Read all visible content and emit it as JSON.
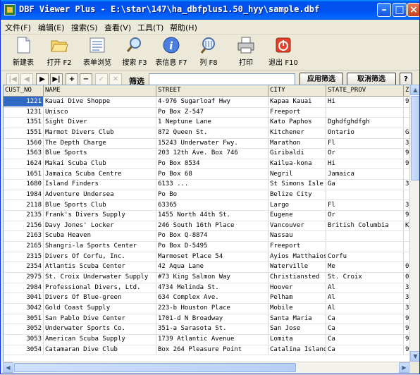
{
  "window": {
    "title": "DBF Viewer Plus - E:\\star\\147\\ha_dbfplus1.50_hyy\\sample.dbf"
  },
  "menu": [
    "文件(F)",
    "编辑(E)",
    "搜索(S)",
    "查看(V)",
    "工具(T)",
    "帮助(H)"
  ],
  "toolbar": [
    {
      "label": "新建表",
      "icon": "new-table-icon"
    },
    {
      "label": "打开 F2",
      "icon": "open-folder-icon"
    },
    {
      "label": "表单浏览",
      "icon": "form-browse-icon"
    },
    {
      "label": "搜索 F3",
      "icon": "search-icon"
    },
    {
      "label": "表信息 F7",
      "icon": "info-icon"
    },
    {
      "label": "列 F8",
      "icon": "columns-icon"
    },
    {
      "label": "打印",
      "icon": "printer-icon"
    },
    {
      "label": "退出 F10",
      "icon": "exit-icon"
    }
  ],
  "nav": {
    "first": "|◀",
    "prev": "◀",
    "next": "▶",
    "last": "▶|",
    "add": "+",
    "delete": "−",
    "post": "✓",
    "cancel": "✕"
  },
  "filter": {
    "label": "筛选",
    "value": "",
    "apply": "应用筛选",
    "cancel": "取消筛选",
    "help": "?"
  },
  "columns": [
    "CUST_NO",
    "NAME",
    "STREET",
    "CITY",
    "STATE_PROV",
    "Z"
  ],
  "rows": [
    [
      "1221",
      "Kauai Dive Shoppe",
      "4-976 Sugarloaf Hwy",
      "Kapaa Kauai",
      "Hi",
      "9"
    ],
    [
      "1231",
      "Unisco",
      "Po Box Z-547",
      "Freeport",
      "",
      ""
    ],
    [
      "1351",
      "Sight Diver",
      "1 Neptune Lane",
      "Kato Paphos",
      "Dghdfghdfgh",
      ""
    ],
    [
      "1551",
      "Marmot Divers Club",
      "872 Queen St.",
      "Kitchener",
      "Ontario",
      "G"
    ],
    [
      "1560",
      "The Depth Charge",
      "15243 Underwater Fwy.",
      "Marathon",
      "Fl",
      "3"
    ],
    [
      "1563",
      "Blue Sports",
      "203 12th Ave. Box 746",
      "Giribaldi",
      "Or",
      "9"
    ],
    [
      "1624",
      "Makai Scuba Club",
      "Po Box 8534",
      "Kailua-kona",
      "Hi",
      "9"
    ],
    [
      "1651",
      "Jamaica Scuba Centre",
      "Po Box 68",
      "Negril",
      "Jamaica",
      ""
    ],
    [
      "1680",
      "Island Finders",
      "6133 ...",
      "St Simons Isle",
      "Ga",
      "3"
    ],
    [
      "1984",
      "Adventure Undersea",
      "Po Bo",
      "Belize City",
      "",
      ""
    ],
    [
      "2118",
      "Blue Sports Club",
      "63365",
      "Largo",
      "Fl",
      "3"
    ],
    [
      "2135",
      "Frank's Divers Supply",
      "1455 North 44th St.",
      "Eugene",
      "Or",
      "9"
    ],
    [
      "2156",
      "Davy Jones' Locker",
      "246 South 16th Place",
      "Vancouver",
      "British Columbia",
      "K"
    ],
    [
      "2163",
      "Scuba Heaven",
      "Po Box Q-8874",
      "Nassau",
      "",
      ""
    ],
    [
      "2165",
      "Shangri-la Sports Center",
      "Po Box D-5495",
      "Freeport",
      "",
      ""
    ],
    [
      "2315",
      "Divers Of Corfu, Inc.",
      "Marmoset Place 54",
      "Ayios Matthaios",
      "Corfu",
      ""
    ],
    [
      "2354",
      "Atlantis Scuba Center",
      "42 Aqua Lane",
      "Waterville",
      "Me",
      "0"
    ],
    [
      "2975",
      "St. Croix Underwater Supply",
      "#73 King Salmon Way",
      "Christiansted",
      "St. Croix",
      "0"
    ],
    [
      "2984",
      "Professional Divers, Ltd.",
      "4734 Melinda St.",
      "Hoover",
      "Al",
      "3"
    ],
    [
      "3041",
      "Divers Of Blue-green",
      "634 Complex Ave.",
      "Pelham",
      "Al",
      "3"
    ],
    [
      "3042",
      "Gold Coast Supply",
      "223-b Houston Place",
      "Mobile",
      "Al",
      "3"
    ],
    [
      "3051",
      "San Pablo Dive Center",
      "1701-d N Broadway",
      "Santa Maria",
      "Ca",
      "9"
    ],
    [
      "3052",
      "Underwater Sports Co.",
      "351-a Sarasota St.",
      "San Jose",
      "Ca",
      "9"
    ],
    [
      "3053",
      "American Scuba Supply",
      "1739 Atlantic Avenue",
      "Lomita",
      "Ca",
      "9"
    ],
    [
      "3054",
      "Catamaran Dive Club",
      "Box 264 Pleasure Point",
      "Catalina Island",
      "Ca",
      "9"
    ]
  ]
}
